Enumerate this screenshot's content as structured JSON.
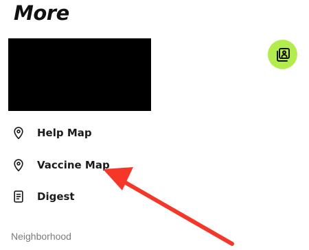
{
  "header": {
    "title": "More"
  },
  "profile": {
    "avatar_icon": "contact-card-icon",
    "accent_color": "#b3ec4e"
  },
  "menu": {
    "items": [
      {
        "label": "Help Map",
        "icon": "map-pin-icon"
      },
      {
        "label": "Vaccine Map",
        "icon": "map-pin-icon"
      },
      {
        "label": "Digest",
        "icon": "document-icon"
      }
    ]
  },
  "sections": {
    "neighborhood_label": "Neighborhood"
  },
  "annotation": {
    "arrow_color": "#f5372a"
  }
}
